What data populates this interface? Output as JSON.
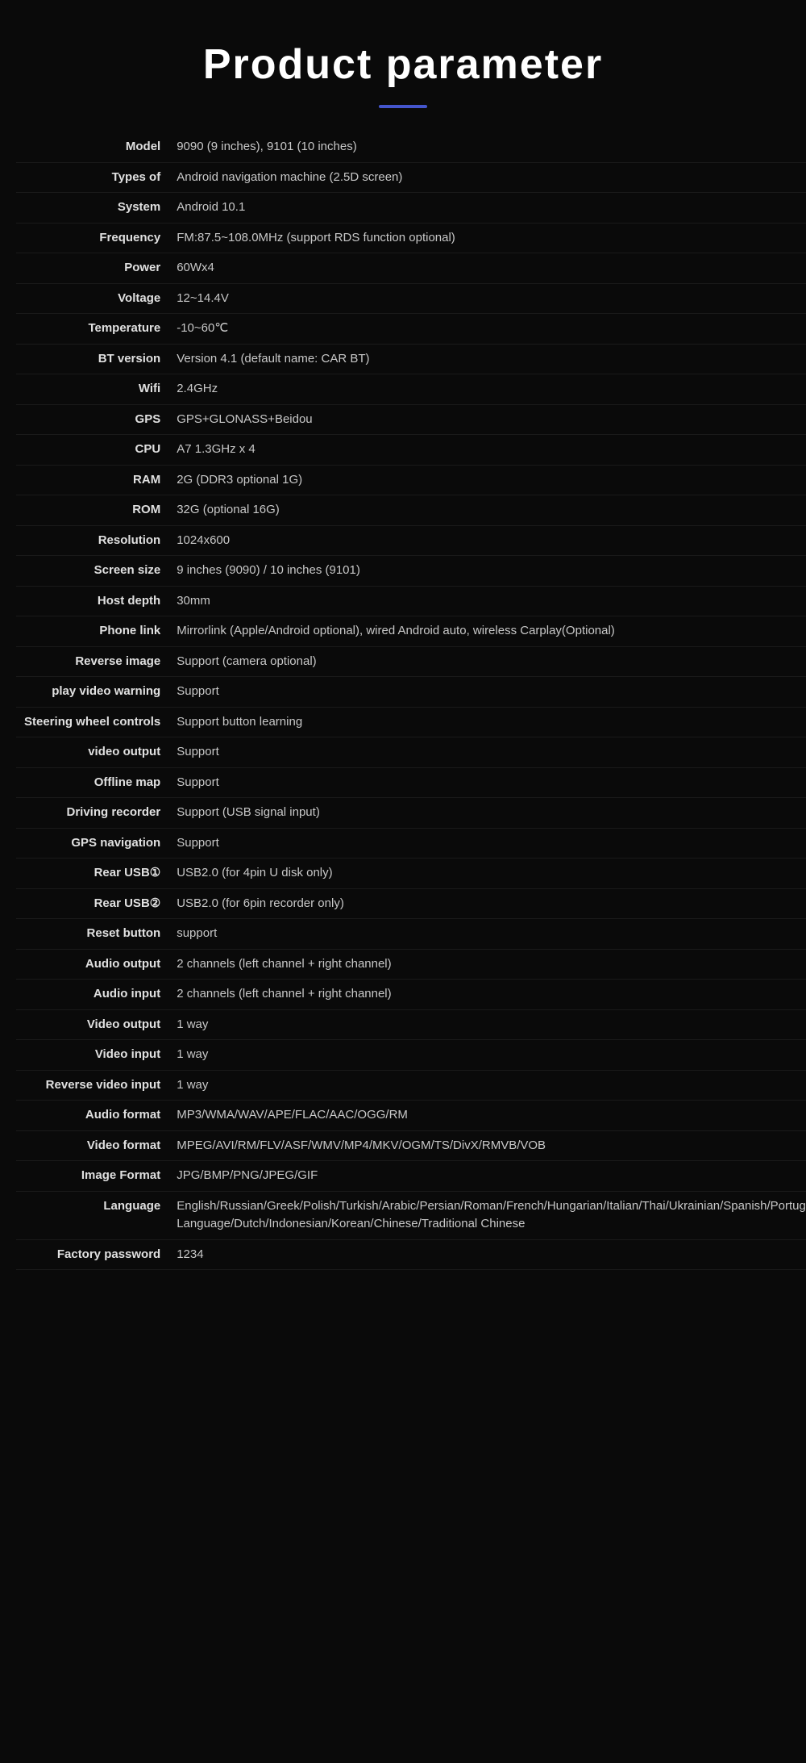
{
  "page": {
    "title": "Product  parameter"
  },
  "params": [
    {
      "label": "Model",
      "value": "9090 (9 inches), 9101 (10 inches)",
      "small": false
    },
    {
      "label": "Types of",
      "value": "Android navigation machine (2.5D screen)",
      "small": false
    },
    {
      "label": "System",
      "value": "Android 10.1",
      "small": false
    },
    {
      "label": "Frequency",
      "value": "FM:87.5~108.0MHz (support RDS function optional)",
      "small": false
    },
    {
      "label": "Power",
      "value": "60Wx4",
      "small": false
    },
    {
      "label": "Voltage",
      "value": "12~14.4V",
      "small": false
    },
    {
      "label": "Temperature",
      "value": "-10~60℃",
      "small": false
    },
    {
      "label": "BT version",
      "value": "Version 4.1 (default name: CAR BT)",
      "small": false
    },
    {
      "label": "Wifi",
      "value": "2.4GHz",
      "small": false
    },
    {
      "label": "GPS",
      "value": "GPS+GLONASS+Beidou",
      "small": false
    },
    {
      "label": "CPU",
      "value": "A7 1.3GHz x 4",
      "small": false
    },
    {
      "label": "RAM",
      "value": "2G (DDR3 optional 1G)",
      "small": false
    },
    {
      "label": "ROM",
      "value": "32G (optional 16G)",
      "small": false
    },
    {
      "label": "Resolution",
      "value": "1024x600",
      "small": false
    },
    {
      "label": "Screen size",
      "value": "9 inches (9090) / 10 inches (9101)",
      "small": false
    },
    {
      "label": "Host depth",
      "value": "30mm",
      "small": false
    },
    {
      "label": "Phone link",
      "value": "Mirrorlink (Apple/Android optional), wired Android auto, wireless Carplay(Optional)",
      "small": false
    },
    {
      "label": "Reverse image",
      "value": "Support (camera optional)",
      "small": false
    },
    {
      "label": "play video warning",
      "value": "Support",
      "small": true
    },
    {
      "label": "Steering wheel controls",
      "value": "Support button learning",
      "small": true
    },
    {
      "label": "video output",
      "value": "Support",
      "small": false
    },
    {
      "label": "Offline map",
      "value": "Support",
      "small": false
    },
    {
      "label": "Driving recorder",
      "value": "Support (USB signal input)",
      "small": true
    },
    {
      "label": "GPS navigation",
      "value": "Support",
      "small": true
    },
    {
      "label": "Rear USB①",
      "value": "USB2.0 (for 4pin U disk only)",
      "small": false
    },
    {
      "label": "Rear USB②",
      "value": "USB2.0 (for 6pin recorder only)",
      "small": false
    },
    {
      "label": "Reset button",
      "value": "support",
      "small": false
    },
    {
      "label": "Audio output",
      "value": "2 channels (left channel + right channel)",
      "small": false
    },
    {
      "label": "Audio input",
      "value": "2 channels (left channel + right channel)",
      "small": false
    },
    {
      "label": "Video output",
      "value": "1 way",
      "small": false
    },
    {
      "label": "Video input",
      "value": "1 way",
      "small": false
    },
    {
      "label": "Reverse video input",
      "value": "1 way",
      "small": true
    },
    {
      "label": "Audio format",
      "value": "MP3/WMA/WAV/APE/FLAC/AAC/OGG/RM",
      "small": false
    },
    {
      "label": "Video format",
      "value": "MPEG/AVI/RM/FLV/ASF/WMV/MP4/MKV/OGM/TS/DivX/RMVB/VOB",
      "small": false
    },
    {
      "label": "Image Format",
      "value": "JPG/BMP/PNG/JPEG/GIF",
      "small": false
    },
    {
      "label": "Language",
      "value": "English/Russian/Greek/Polish/Turkish/Arabic/Persian/Roman/French/Hungarian/Italian/Thai/Ukrainian/Spanish/Portuguese/Czech/Vietnamese/Japanese/Ma Language/Dutch/Indonesian/Korean/Chinese/Traditional Chinese",
      "small": false
    },
    {
      "label": "Factory password",
      "value": "1234",
      "small": false
    }
  ]
}
